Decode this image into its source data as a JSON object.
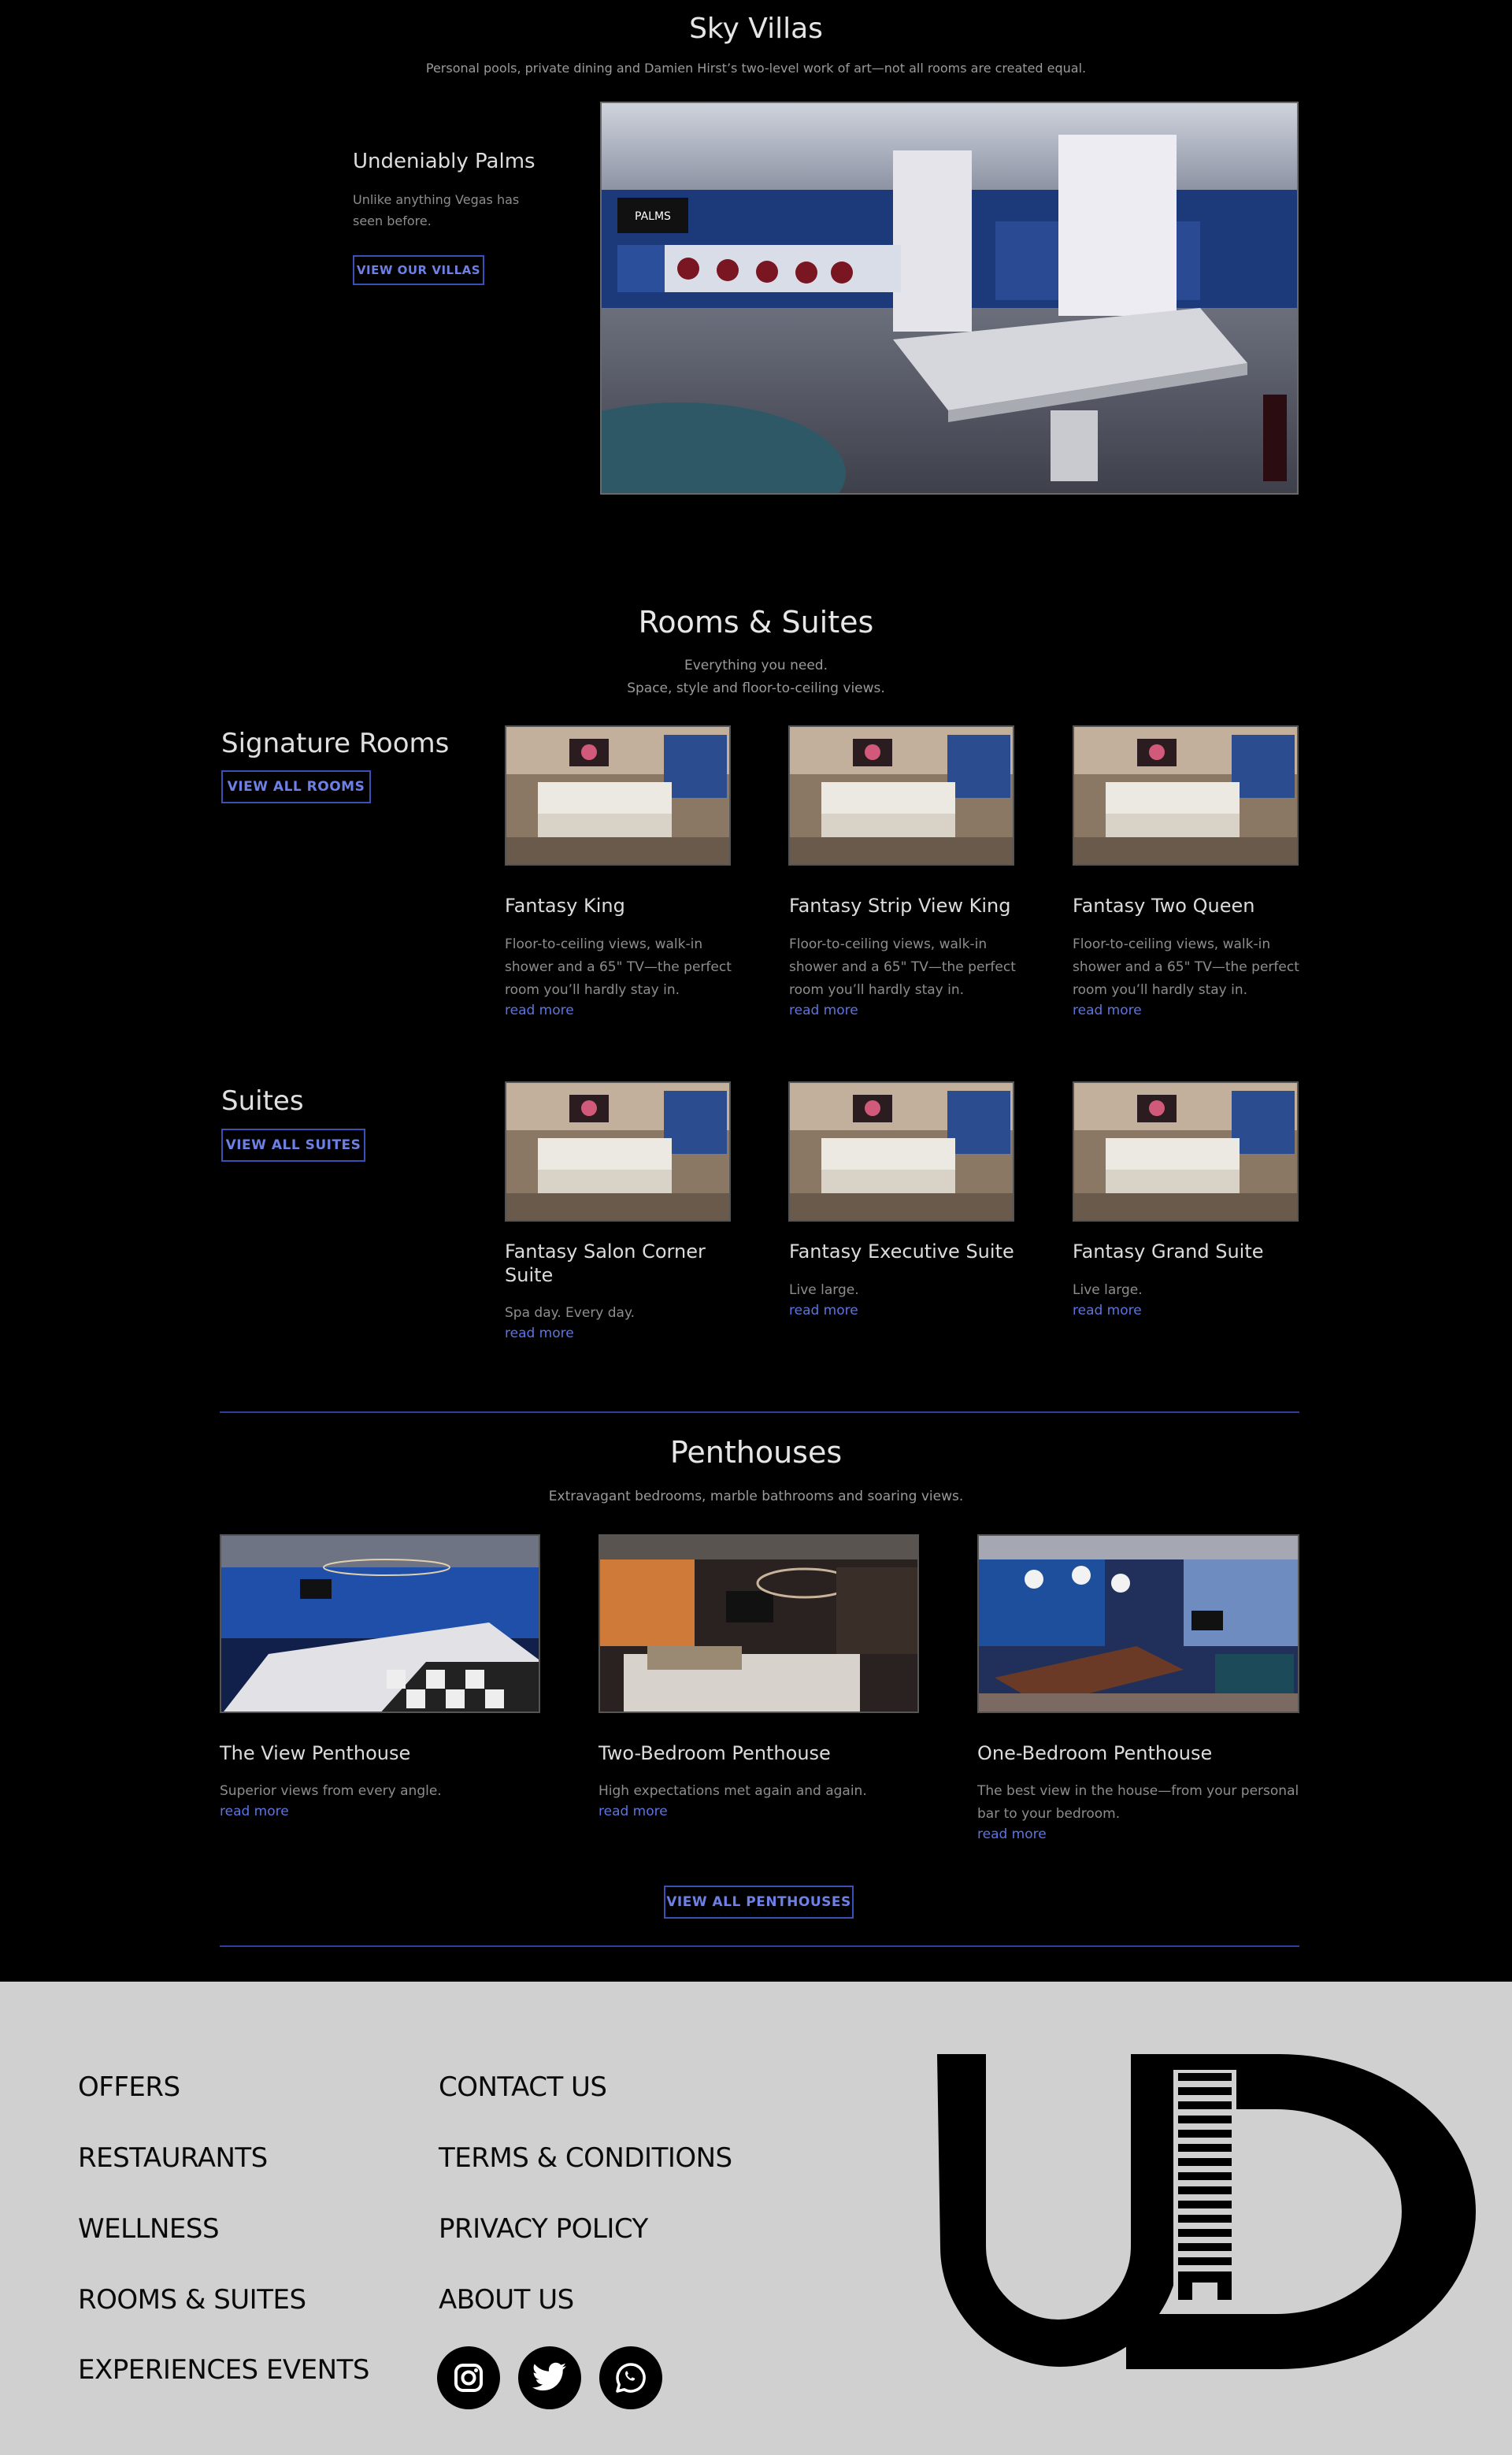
{
  "sky_villas": {
    "title": "Sky Villas",
    "subtitle": "Personal pools, private dining and Damien Hirst’s two-level work of art—not all rooms are created equal.",
    "feature_title": "Undeniably Palms",
    "feature_desc": "Unlike anything Vegas has seen before.",
    "button": "VIEW OUR VILLAS",
    "photo_sign": "PALMS"
  },
  "rooms_suites": {
    "title": "Rooms & Suites",
    "subtitle_line1": "Everything you need.",
    "subtitle_line2": "Space, style and floor-to-ceiling views.",
    "signature_heading": "Signature Rooms",
    "signature_button": "VIEW ALL ROOMS",
    "rooms": [
      {
        "title": "Fantasy King",
        "desc": "Floor-to-ceiling views, walk-in shower and a 65\" TV—the perfect room you’ll hardly stay in.",
        "link": "read more"
      },
      {
        "title": "Fantasy Strip View King",
        "desc": "Floor-to-ceiling views, walk-in shower and a 65\" TV—the perfect room you’ll hardly stay in.",
        "link": "read more"
      },
      {
        "title": "Fantasy Two Queen",
        "desc": "Floor-to-ceiling views, walk-in shower and a 65\" TV—the perfect room you’ll hardly stay in.",
        "link": "read more"
      }
    ],
    "suites_heading": "Suites",
    "suites_button": "VIEW ALL SUITES",
    "suites": [
      {
        "title": "Fantasy Salon Corner Suite",
        "desc": "Spa day. Every day.",
        "link": "read more"
      },
      {
        "title": "Fantasy Executive Suite",
        "desc": "Live large.",
        "link": "read more"
      },
      {
        "title": "Fantasy Grand Suite",
        "desc": "Live large.",
        "link": "read more"
      }
    ]
  },
  "penthouses": {
    "title": "Penthouses",
    "subtitle": "Extravagant bedrooms, marble bathrooms and soaring views.",
    "items": [
      {
        "title": "The View Penthouse",
        "desc": "Superior views from every angle.",
        "link": "read more"
      },
      {
        "title": "Two-Bedroom Penthouse",
        "desc": "High expectations met again and again.",
        "link": "read more"
      },
      {
        "title": "One-Bedroom Penthouse",
        "desc": "The best view in the house—from your personal bar to your bedroom.",
        "link": "read more"
      }
    ],
    "button": "VIEW ALL PENTHOUSES"
  },
  "footer": {
    "col1": [
      "OFFERS",
      "RESTAURANTS",
      "WELLNESS",
      "ROOMS & SUITES",
      "EXPERIENCES EVENTS"
    ],
    "col2": [
      "CONTACT US",
      "TERMS & CONDITIONS",
      "PRIVACY POLICY",
      "ABOUT US"
    ],
    "social_icons": [
      "instagram-icon",
      "twitter-icon",
      "whatsapp-icon"
    ],
    "logo_text": "UD"
  },
  "colors": {
    "accent": "#3b4fb8",
    "link": "#5d74e0",
    "footer_bg": "#d0d0d0",
    "page_bg": "#000000"
  }
}
